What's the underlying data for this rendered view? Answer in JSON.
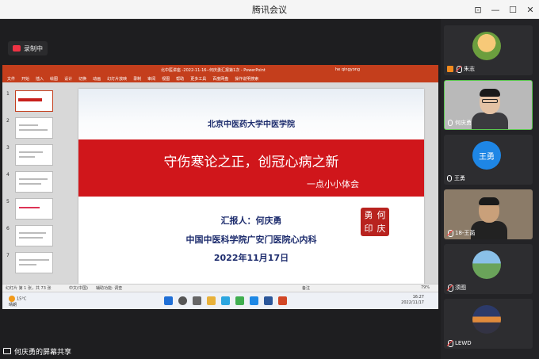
{
  "window": {
    "title": "腾讯会议",
    "controls": [
      "pin-icon",
      "minimize-icon",
      "maximize-icon",
      "close-icon"
    ]
  },
  "recording": {
    "label": "录制中"
  },
  "share_label": "何庆勇的屏幕共享",
  "powerpoint": {
    "title": "北中医讲座 -2022-11-16--何庆勇汇报第1次 - PowerPoint",
    "user": "he qingyong",
    "menu": [
      "文件",
      "开始",
      "插入",
      "绘图",
      "设计",
      "切换",
      "动画",
      "幻灯片放映",
      "录制",
      "审阅",
      "视图",
      "帮助",
      "更多工具",
      "百度网盘",
      "操作说明搜索"
    ],
    "thumbnail_numbers": [
      "1",
      "2",
      "3",
      "4",
      "5",
      "6",
      "7"
    ],
    "status_left": "幻灯片 第 1 张，共 73 张",
    "status_lang": "中文(中国)",
    "status_access": "辅助功能: 调查",
    "status_notes": "备注",
    "zoom": "79%"
  },
  "slide": {
    "university": "北京中医药大学中医学院",
    "title": "守伤寒论之正，创冠心病之新",
    "subtitle": "一点小小体会",
    "reporter": "汇报人：何庆勇",
    "hospital": "中国中医科学院广安门医院心内科",
    "date": "2022年11月17日",
    "seal_chars": [
      "勇",
      "何",
      "印",
      "庆"
    ]
  },
  "taskbar": {
    "temp": "15°C",
    "weather": "晴朗",
    "time": "16:27",
    "date": "2022/11/17"
  },
  "participants": [
    {
      "name": "朱志",
      "kind": "photo1"
    },
    {
      "name": "何庆勇",
      "kind": "video"
    },
    {
      "name": "王勇",
      "kind": "text",
      "avatar_text": "王勇"
    },
    {
      "name": "18-王菡",
      "kind": "video2"
    },
    {
      "name": "须图",
      "kind": "photo2"
    },
    {
      "name": "LEWD",
      "kind": "photo3"
    }
  ],
  "colors": {
    "ppt_red": "#c43e1c",
    "slide_band": "#d0161b",
    "slide_text": "#1e2d6e",
    "panel_bg": "#232326"
  }
}
